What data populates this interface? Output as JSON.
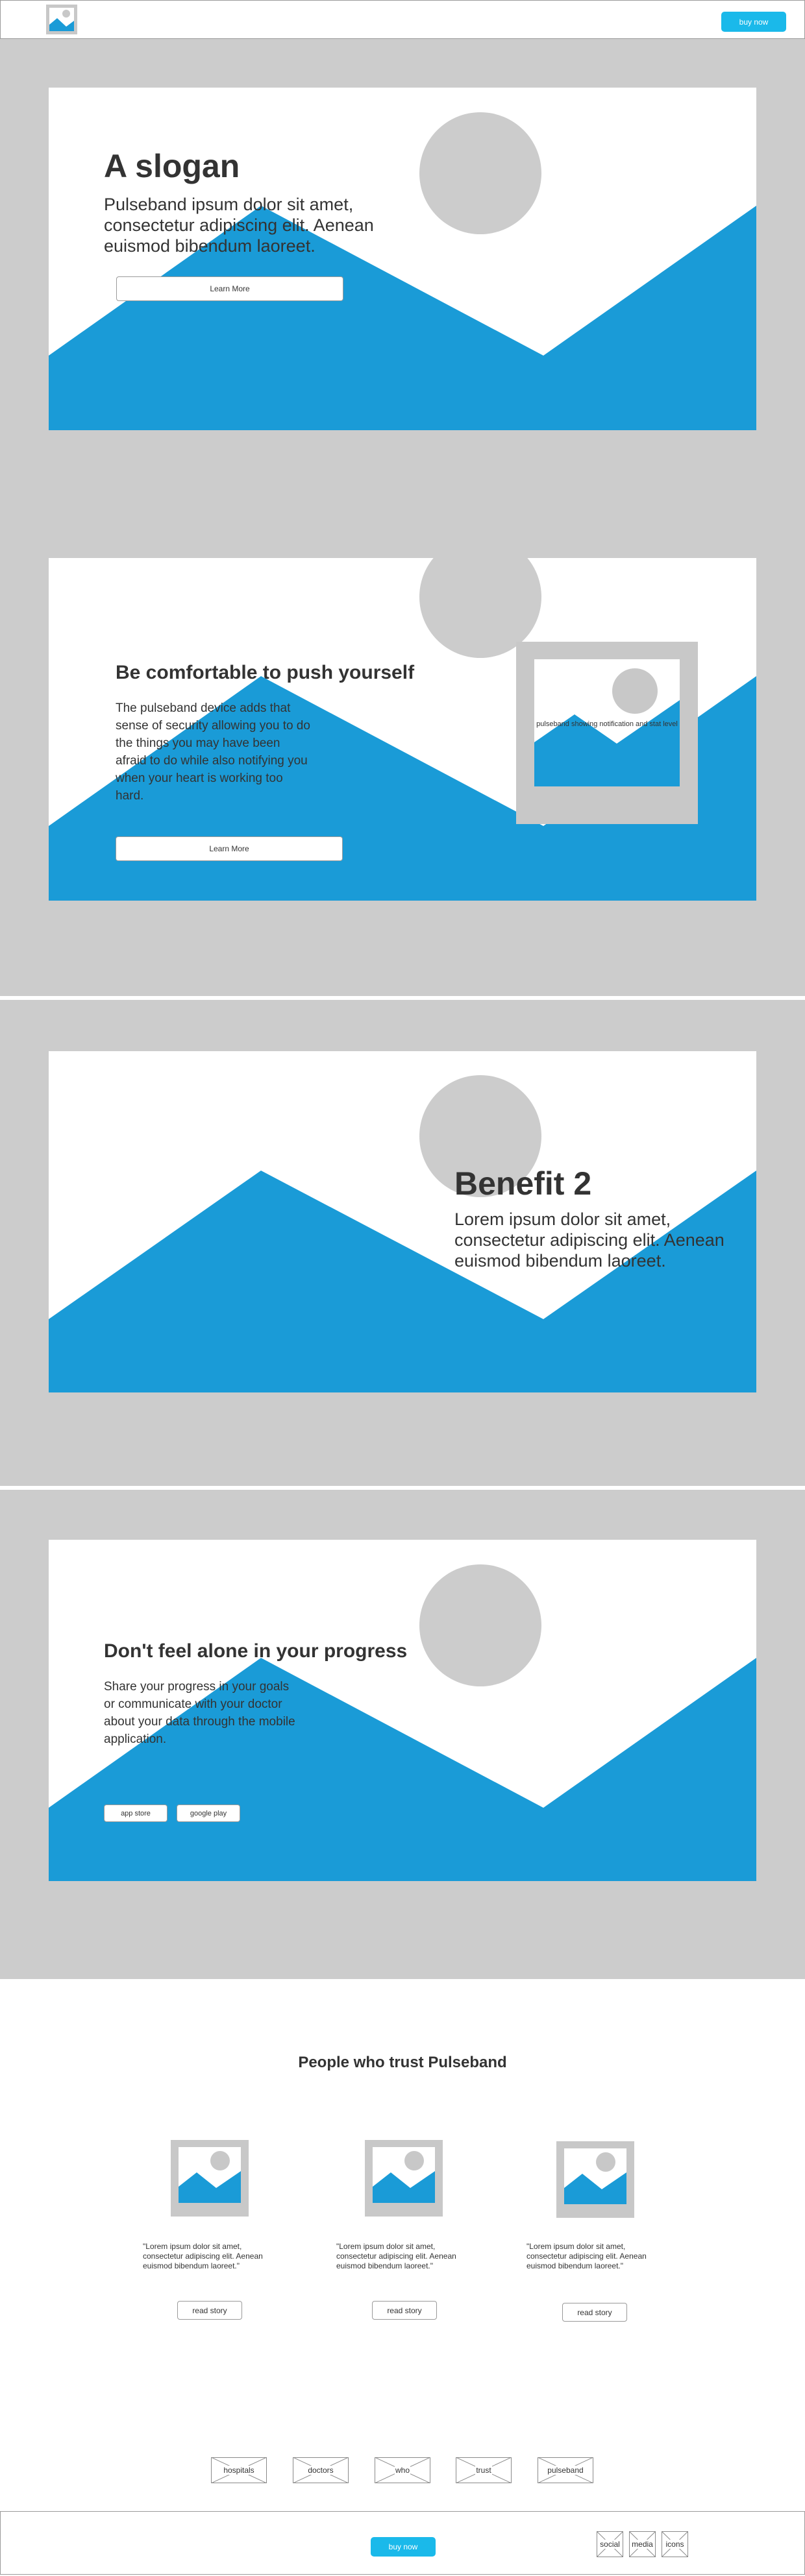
{
  "header": {
    "logo": "image-placeholder-icon",
    "buy_label": "buy now"
  },
  "colors": {
    "accent": "#1ab9ea",
    "mountain": "#1a9bd7",
    "band_grey": "#cccccc",
    "placeholder_grey": "#c8c8c8",
    "text": "#333333"
  },
  "hero": {
    "title": "A slogan",
    "lead": "Pulseband ipsum dolor sit amet, consectetur adipiscing elit. Aenean euismod bibendum laoreet.",
    "button_label": "Learn More"
  },
  "comfort": {
    "title": "Be comfortable to push yourself",
    "body": "The pulseband device adds that sense of security allowing you to do the things you may have been afraid to do while also notifying you when your heart is working too hard.",
    "image_caption": "pulseband showing notification and stat level",
    "button_label": "Learn More"
  },
  "benefit": {
    "title": "Benefit 2",
    "lead": "Lorem ipsum dolor sit amet, consectetur adipiscing elit. Aenean euismod bibendum laoreet."
  },
  "progress": {
    "title": "Don't feel alone in your progress",
    "body": "Share your progress in your goals or communicate with your doctor about your data through the mobile application.",
    "app_store_label": "app store",
    "google_play_label": "google play"
  },
  "testimonials": {
    "heading": "People who trust Pulseband",
    "items": [
      {
        "quote": "\"Lorem ipsum dolor sit amet, consectetur adipiscing elit. Aenean euismod bibendum laoreet.\"",
        "button_label": "read story"
      },
      {
        "quote": "\"Lorem ipsum dolor sit amet, consectetur adipiscing elit. Aenean euismod bibendum laoreet.\"",
        "button_label": "read story"
      },
      {
        "quote": "\"Lorem ipsum dolor sit amet, consectetur adipiscing elit. Aenean euismod bibendum laoreet.\"",
        "button_label": "read story"
      }
    ]
  },
  "audiences": [
    "hospitals",
    "doctors",
    "who",
    "trust",
    "pulseband"
  ],
  "footer": {
    "buy_label": "buy now",
    "links": [
      "social",
      "media",
      "icons"
    ]
  }
}
